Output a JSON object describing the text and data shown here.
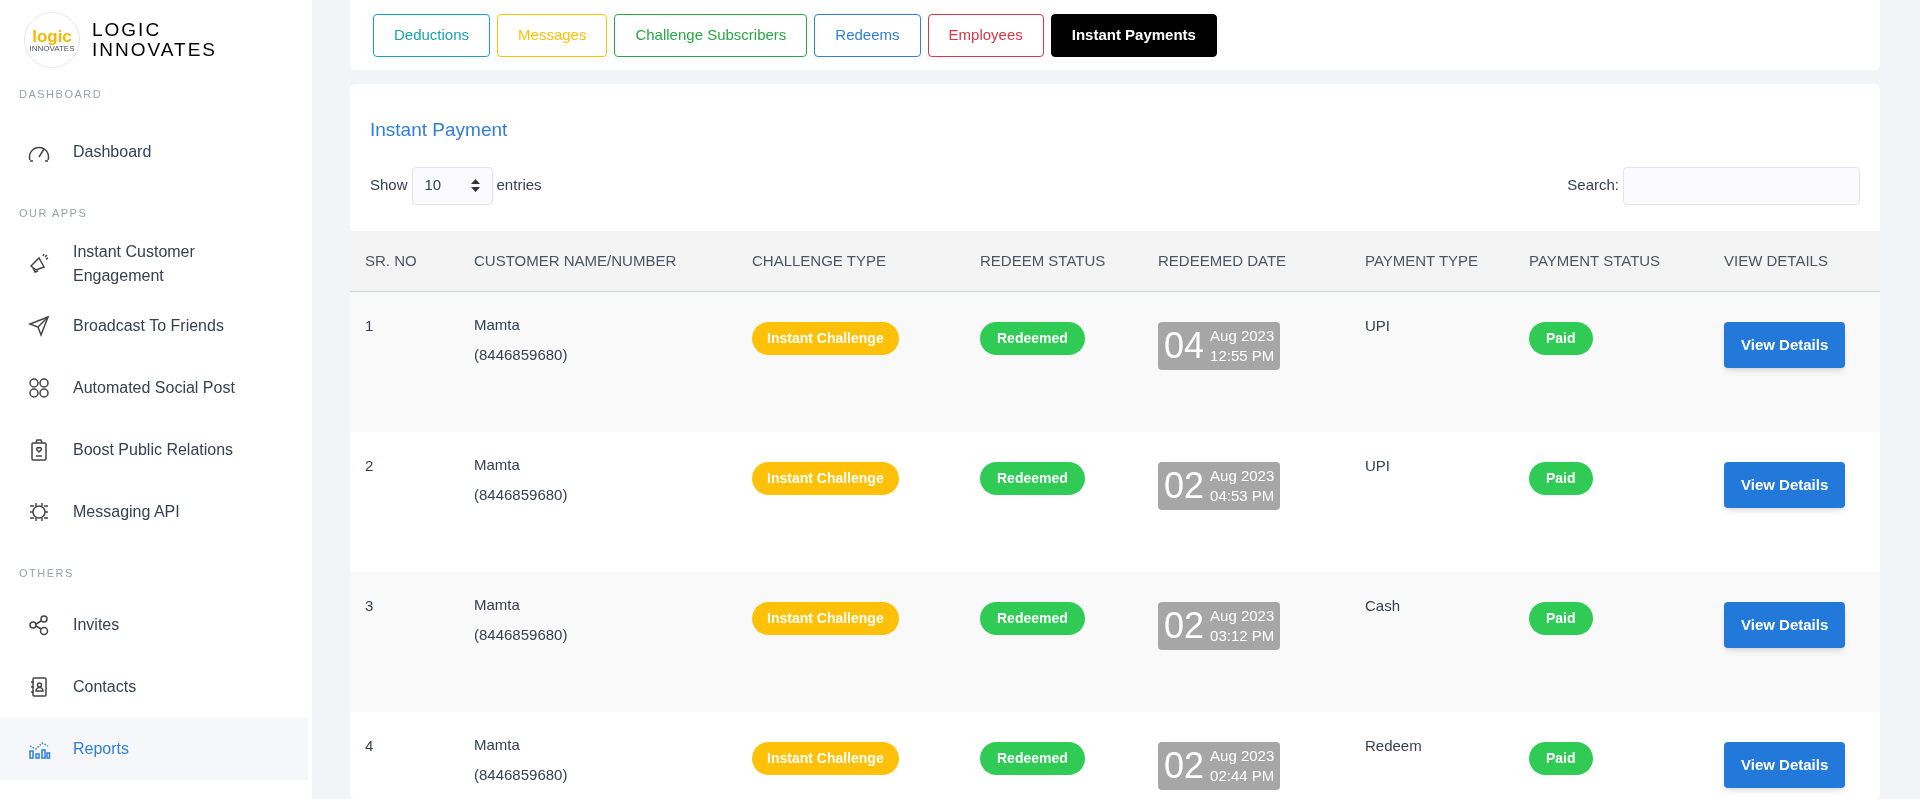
{
  "brand": {
    "name_line1": "LOGIC",
    "name_line2": "INNOVATES",
    "logo_text": "logic",
    "logo_subtext": "INNOVATES"
  },
  "sidebar": {
    "sections": [
      {
        "heading": "DASHBOARD",
        "items": [
          {
            "label": "Dashboard",
            "selected": false
          }
        ]
      },
      {
        "heading": "OUR APPS",
        "items": [
          {
            "label": "Instant Customer Engagement",
            "selected": false
          },
          {
            "label": "Broadcast To Friends",
            "selected": false
          },
          {
            "label": "Automated Social Post",
            "selected": false
          },
          {
            "label": "Boost Public Relations",
            "selected": false
          },
          {
            "label": "Messaging API",
            "selected": false
          }
        ]
      },
      {
        "heading": "OTHERS",
        "items": [
          {
            "label": "Invites",
            "selected": false
          },
          {
            "label": "Contacts",
            "selected": false
          },
          {
            "label": "Reports",
            "selected": true
          }
        ]
      }
    ]
  },
  "tabs": [
    {
      "label": "Deductions",
      "color": "#17a2b8",
      "selected": false
    },
    {
      "label": "Messages",
      "color": "#ffc107",
      "selected": false
    },
    {
      "label": "Challenge Subscribers",
      "color": "#28a745",
      "selected": false
    },
    {
      "label": "Redeems",
      "color": "#2f7fd8",
      "selected": false
    },
    {
      "label": "Employees",
      "color": "#dc3545",
      "selected": false
    },
    {
      "label": "Instant Payments",
      "color": "#000000",
      "selected": true
    }
  ],
  "panel": {
    "title": "Instant Payment",
    "show_label": "Show",
    "page_size": "10",
    "entries_label": "entries",
    "search_label": "Search:"
  },
  "table": {
    "columns": [
      "SR. NO",
      "CUSTOMER NAME/NUMBER",
      "CHALLENGE TYPE",
      "REDEEM STATUS",
      "REDEEMED DATE",
      "PAYMENT TYPE",
      "PAYMENT STATUS",
      "VIEW DETAILS"
    ],
    "rows": [
      {
        "sr": "1",
        "name": "Mamta",
        "number": "(8446859680)",
        "challenge_type": "Instant Challenge",
        "redeem_status": "Redeemed",
        "day": "04",
        "month_year": "Aug 2023",
        "time": "12:55 PM",
        "payment_type": "UPI",
        "payment_status": "Paid",
        "action": "View Details"
      },
      {
        "sr": "2",
        "name": "Mamta",
        "number": "(8446859680)",
        "challenge_type": "Instant Challenge",
        "redeem_status": "Redeemed",
        "day": "02",
        "month_year": "Aug 2023",
        "time": "04:53 PM",
        "payment_type": "UPI",
        "payment_status": "Paid",
        "action": "View Details"
      },
      {
        "sr": "3",
        "name": "Mamta",
        "number": "(8446859680)",
        "challenge_type": "Instant Challenge",
        "redeem_status": "Redeemed",
        "day": "02",
        "month_year": "Aug 2023",
        "time": "03:12 PM",
        "payment_type": "Cash",
        "payment_status": "Paid",
        "action": "View Details"
      },
      {
        "sr": "4",
        "name": "Mamta",
        "number": "(8446859680)",
        "challenge_type": "Instant Challenge",
        "redeem_status": "Redeemed",
        "day": "02",
        "month_year": "Aug 2023",
        "time": "02:44 PM",
        "payment_type": "Redeem",
        "payment_status": "Paid",
        "action": "View Details"
      }
    ]
  }
}
